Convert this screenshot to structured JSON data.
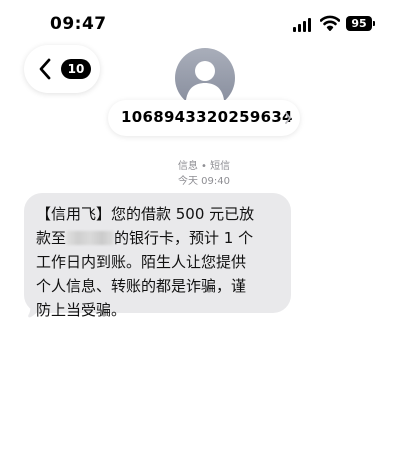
{
  "status_bar": {
    "time": "09:47",
    "battery": "95"
  },
  "nav": {
    "back_count": "10"
  },
  "contact": {
    "number": "1068943320259634"
  },
  "meta": {
    "service": "信息 • 短信",
    "timestamp": "今天 09:40"
  },
  "message": {
    "lines": [
      "【信用飞】您的借款 500 元已放",
      "款至",
      "的银行卡，预计 1 个",
      "工作日内到账。陌生人让您提供",
      "个人信息、转账的都是诈骗，谨",
      "防上当受骗。"
    ]
  },
  "colors": {
    "bubble": "#e9e9eb",
    "meta_text": "#8e8e93"
  },
  "icons": [
    "signal-icon",
    "wifi-icon",
    "battery-icon",
    "back-chevron-icon",
    "avatar-person-icon",
    "chevron-right-icon"
  ]
}
